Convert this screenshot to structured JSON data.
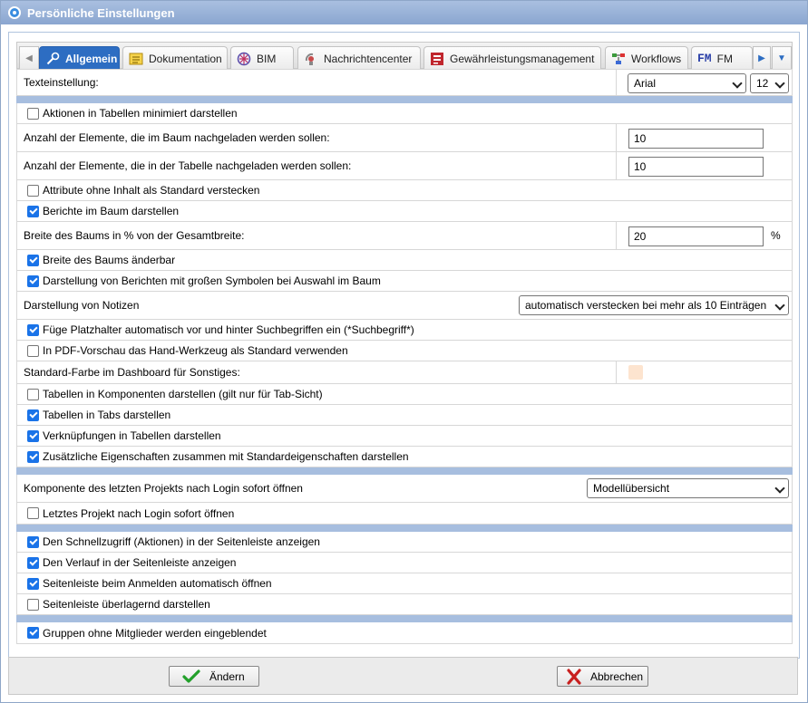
{
  "window": {
    "title": "Persönliche Einstellungen"
  },
  "tabs": [
    {
      "label": "Allgemein",
      "icon": "wrench-icon",
      "active": true
    },
    {
      "label": "Dokumentation",
      "icon": "documentation-icon"
    },
    {
      "label": "BIM",
      "icon": "bim-icon"
    },
    {
      "label": "Nachrichtencenter",
      "icon": "message-center-icon"
    },
    {
      "label": "Gewährleistungsmanagement",
      "icon": "warranty-icon"
    },
    {
      "label": "Workflows",
      "icon": "workflow-icon"
    },
    {
      "label": "FM",
      "icon": "fm-icon",
      "icon_text": "FM"
    }
  ],
  "text_settings": {
    "label": "Texteinstellung:",
    "font": "Arial",
    "size": "12"
  },
  "rows": {
    "minimize_actions": {
      "label": "Aktionen in Tabellen minimiert darstellen",
      "checked": false
    },
    "tree_load_count": {
      "label": "Anzahl der Elemente, die im Baum nachgeladen werden sollen:",
      "value": "10"
    },
    "table_load_count": {
      "label": "Anzahl der Elemente, die in der Tabelle nachgeladen werden sollen:",
      "value": "10"
    },
    "hide_empty_attrs": {
      "label": "Attribute ohne Inhalt als Standard verstecken",
      "checked": false
    },
    "reports_in_tree": {
      "label": "Berichte im Baum darstellen",
      "checked": true
    },
    "tree_width": {
      "label": "Breite des Baums in % von der Gesamtbreite:",
      "value": "20",
      "unit": "%"
    },
    "tree_width_resizable": {
      "label": "Breite des Baums änderbar",
      "checked": true
    },
    "large_report_symbols": {
      "label": "Darstellung von Berichten mit großen Symbolen bei Auswahl im Baum",
      "checked": true
    },
    "notes_display": {
      "label": "Darstellung von Notizen",
      "value": "automatisch verstecken bei mehr als 10 Einträgen"
    },
    "search_wildcards": {
      "label": "Füge Platzhalter automatisch vor und hinter Suchbegriffen ein (*Suchbegriff*)",
      "checked": true
    },
    "pdf_hand_tool": {
      "label": "In PDF-Vorschau das Hand-Werkzeug als Standard verwenden",
      "checked": false
    },
    "dashboard_color": {
      "label": "Standard-Farbe im Dashboard für Sonstiges:",
      "color": "#fde4cf"
    },
    "tables_in_components": {
      "label": "Tabellen in Komponenten darstellen (gilt nur für Tab-Sicht)",
      "checked": false
    },
    "tables_in_tabs": {
      "label": "Tabellen in Tabs darstellen",
      "checked": true
    },
    "links_in_tables": {
      "label": "Verknüpfungen in Tabellen darstellen",
      "checked": true
    },
    "extra_properties": {
      "label": "Zusätzliche Eigenschaften zusammen mit Standardeigenschaften darstellen",
      "checked": true
    },
    "last_project_component": {
      "label": "Komponente des letzten Projekts nach Login sofort öffnen",
      "value": "Modellübersicht"
    },
    "open_last_project": {
      "label": "Letztes Projekt nach Login sofort öffnen",
      "checked": false
    },
    "quick_access_sidebar": {
      "label": "Den Schnellzugriff (Aktionen) in der Seitenleiste anzeigen",
      "checked": true
    },
    "history_sidebar": {
      "label": "Den Verlauf in der Seitenleiste anzeigen",
      "checked": true
    },
    "auto_open_sidebar": {
      "label": "Seitenleiste beim Anmelden automatisch öffnen",
      "checked": true
    },
    "overlay_sidebar": {
      "label": "Seitenleiste überlagernd darstellen",
      "checked": false
    },
    "groups_without_members": {
      "label": "Gruppen ohne Mitglieder werden eingeblendet",
      "checked": true
    }
  },
  "footer": {
    "save_label": "Ändern",
    "cancel_label": "Abbrechen"
  },
  "colors": {
    "title_bar": "#8aa6d0",
    "active_tab": "#2d6dc2",
    "separator": "#a7bedf",
    "checkbox": "#1a73e8"
  }
}
